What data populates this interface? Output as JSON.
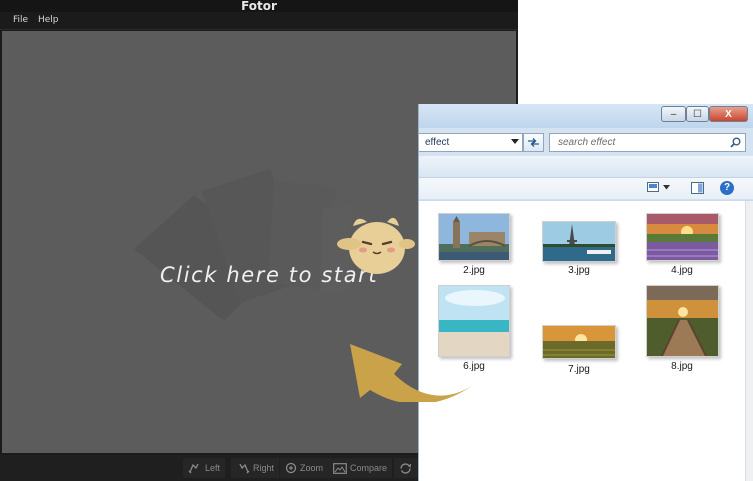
{
  "fotor": {
    "title": "Fotor",
    "menu": [
      "File",
      "Help"
    ],
    "canvas_prompt": "Click here to start",
    "toolbar": [
      {
        "label": "Left",
        "icon": "rotate-left-icon"
      },
      {
        "label": "Right",
        "icon": "rotate-right-icon"
      },
      {
        "label": "Zoom",
        "icon": "zoom-icon"
      },
      {
        "label": "Compare",
        "icon": "compare-icon"
      },
      {
        "label": "",
        "icon": "rotate-icon"
      }
    ]
  },
  "explorer": {
    "window_buttons": {
      "minimize": "–",
      "maximize": "☐",
      "close": "X"
    },
    "address": "effect",
    "search_placeholder": "search effect",
    "help_label": "?",
    "files": [
      {
        "name": "2.jpg",
        "scene": "london"
      },
      {
        "name": "3.jpg",
        "scene": "paris"
      },
      {
        "name": "4.jpg",
        "scene": "lavender"
      },
      {
        "name": "6.jpg",
        "scene": "beach"
      },
      {
        "name": "7.jpg",
        "scene": "field-sunset"
      },
      {
        "name": "8.jpg",
        "scene": "boardwalk"
      }
    ]
  },
  "colors": {
    "fotor_background": "#1b1b1b",
    "canvas_gray": "#5c5c5c",
    "arrow_gold": "#c9a24a",
    "explorer_chrome": "#c7dbee",
    "close_red": "#c8472c"
  }
}
